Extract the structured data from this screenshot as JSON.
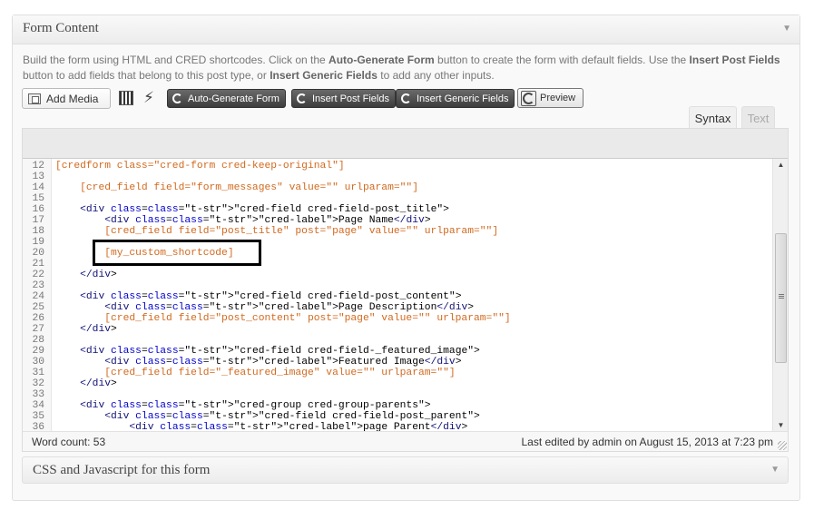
{
  "panel": {
    "title": "Form Content",
    "collapse_glyph": "▼",
    "description_parts": [
      "Build the form using HTML and CRED shortcodes. Click on the ",
      "Auto-Generate Form",
      " button to create the form with default fields. Use the ",
      "Insert Post Fields",
      " button to add fields that belong to this post type, or ",
      "Insert Generic Fields",
      " to add any other inputs."
    ]
  },
  "toolbar": {
    "add_media_label": "Add Media",
    "add_media_icon": "media-icon",
    "extra_icons": [
      "barcode-icon",
      "wand-icon"
    ],
    "auto_generate_label": "Auto-Generate Form",
    "insert_post_fields_label": "Insert Post Fields",
    "insert_generic_fields_label": "Insert Generic Fields",
    "preview_label": "Preview"
  },
  "tabs": {
    "syntax": "Syntax",
    "text": "Text",
    "active": "syntax"
  },
  "editor": {
    "lines": [
      {
        "n": "12",
        "code": "[credform class=\"cred-form cred-keep-original\"]"
      },
      {
        "n": "13",
        "code": ""
      },
      {
        "n": "14",
        "code": "    [cred_field field=\"form_messages\" value=\"\" urlparam=\"\"]"
      },
      {
        "n": "15",
        "code": ""
      },
      {
        "n": "16",
        "code": "    <div class=\"cred-field cred-field-post_title\">"
      },
      {
        "n": "17",
        "code": "        <div class=\"cred-label\">Page Name</div>"
      },
      {
        "n": "18",
        "code": "        [cred_field field=\"post_title\" post=\"page\" value=\"\" urlparam=\"\"]"
      },
      {
        "n": "19",
        "code": ""
      },
      {
        "n": "20",
        "code": "        [my_custom_shortcode]"
      },
      {
        "n": "21",
        "code": ""
      },
      {
        "n": "22",
        "code": "    </div>"
      },
      {
        "n": "23",
        "code": ""
      },
      {
        "n": "24",
        "code": "    <div class=\"cred-field cred-field-post_content\">"
      },
      {
        "n": "25",
        "code": "        <div class=\"cred-label\">Page Description</div>"
      },
      {
        "n": "26",
        "code": "        [cred_field field=\"post_content\" post=\"page\" value=\"\" urlparam=\"\"]"
      },
      {
        "n": "27",
        "code": "    </div>"
      },
      {
        "n": "28",
        "code": ""
      },
      {
        "n": "29",
        "code": "    <div class=\"cred-field cred-field-_featured_image\">"
      },
      {
        "n": "30",
        "code": "        <div class=\"cred-label\">Featured Image</div>"
      },
      {
        "n": "31",
        "code": "        [cred_field field=\"_featured_image\" value=\"\" urlparam=\"\"]"
      },
      {
        "n": "32",
        "code": "    </div>"
      },
      {
        "n": "33",
        "code": ""
      },
      {
        "n": "34",
        "code": "    <div class=\"cred-group cred-group-parents\">"
      },
      {
        "n": "35",
        "code": "        <div class=\"cred-field cred-field-post_parent\">"
      },
      {
        "n": "36",
        "code": "            <div class=\"cred-label\">page Parent</div>"
      }
    ],
    "highlighted_line": "20"
  },
  "status": {
    "word_count": "Word count: 53",
    "last_edited": "Last edited by admin on August 15, 2013 at 7:23 pm"
  },
  "css_panel": {
    "title": "CSS and Javascript for this form",
    "collapse_glyph": "▼"
  }
}
